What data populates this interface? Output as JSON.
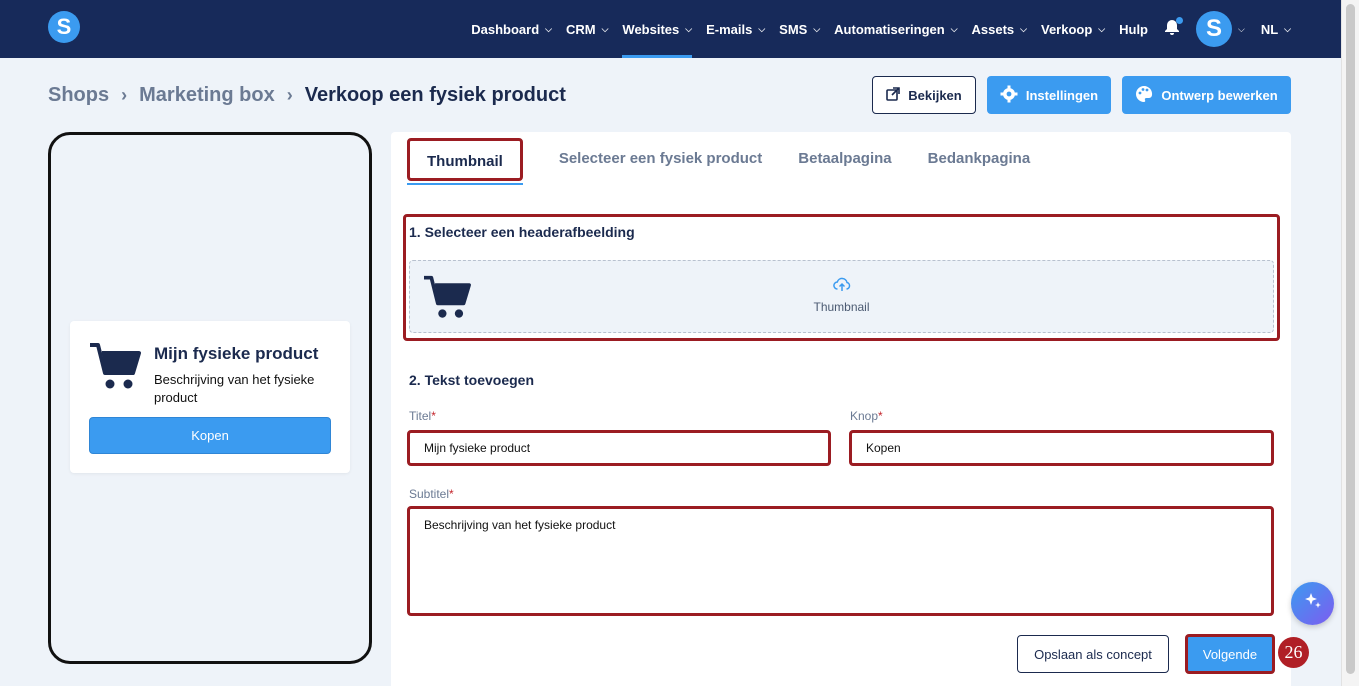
{
  "nav": {
    "logo": "S",
    "items": [
      {
        "label": "Dashboard",
        "chevron": true
      },
      {
        "label": "CRM",
        "chevron": true
      },
      {
        "label": "Websites",
        "chevron": true,
        "active": true
      },
      {
        "label": "E-mails",
        "chevron": true
      },
      {
        "label": "SMS",
        "chevron": true
      },
      {
        "label": "Automatiseringen",
        "chevron": true
      },
      {
        "label": "Assets",
        "chevron": true
      },
      {
        "label": "Verkoop",
        "chevron": true
      },
      {
        "label": "Hulp",
        "chevron": false
      }
    ],
    "avatar": "S",
    "language": "NL"
  },
  "breadcrumb": {
    "items": [
      "Shops",
      "Marketing box"
    ],
    "current": "Verkoop een fysiek product"
  },
  "actions": {
    "view": "Bekijken",
    "settings": "Instellingen",
    "design": "Ontwerp bewerken"
  },
  "preview": {
    "title": "Mijn fysieke product",
    "subtitle": "Beschrijving van het fysieke product",
    "button": "Kopen"
  },
  "tabs": [
    {
      "label": "Thumbnail",
      "active": true
    },
    {
      "label": "Selecteer een fysiek product"
    },
    {
      "label": "Betaalpagina"
    },
    {
      "label": "Bedankpagina"
    }
  ],
  "section1": {
    "title": "1. Selecteer een headerafbeelding",
    "upload_label": "Thumbnail"
  },
  "section2": {
    "title": "2. Tekst toevoegen",
    "title_label": "Titel",
    "title_value": "Mijn fysieke product",
    "button_label": "Knop",
    "button_value": "Kopen",
    "subtitle_label": "Subtitel",
    "subtitle_value": "Beschrijving van het fysieke product",
    "required_mark": "*"
  },
  "footer": {
    "draft": "Opslaan als concept",
    "next": "Volgende"
  },
  "step_badge": "26",
  "colors": {
    "navbar": "#172a5a",
    "primary": "#3b9bf0",
    "highlight": "#9b1c22"
  }
}
